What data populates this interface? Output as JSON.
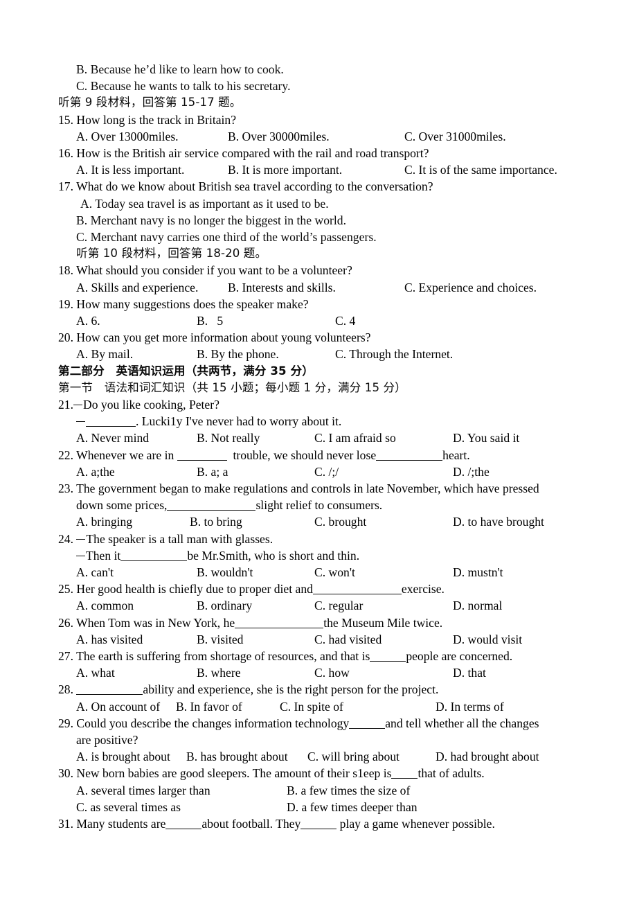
{
  "document": {
    "type": "exam-paper",
    "language": "en-zh",
    "ink_color": "#0b0b0b",
    "paper_color": "#ffffff"
  },
  "listening": {
    "carryover_options": [
      "B. Because he’d like to learn how to cook.",
      "C. Because he wants to talk to his secretary."
    ],
    "direction_9": "听第 9 段材料，回答第 15-17 题。",
    "direction_10": "听第 10 段材料，回答第 18-20 题。",
    "questions": [
      {
        "number": "15.",
        "stem": "How long is the track in Britain?",
        "layout": "three-col",
        "options": [
          "A. Over 13000miles.",
          "B. Over 30000miles.",
          "C. Over 31000miles."
        ]
      },
      {
        "number": "16.",
        "stem": "How is the British air service compared with the rail and road transport?",
        "layout": "three-col",
        "options": [
          "A. It is less important.",
          "B. It is more important.",
          "C. It is of the same importance."
        ]
      },
      {
        "number": "17.",
        "stem": "What do we know about British sea travel according to the conversation?",
        "layout": "stacked",
        "options": [
          "A. Today sea travel is as important as it used to be.",
          "B. Merchant navy is no longer the biggest in the world.",
          "C. Merchant navy carries one third of the world’s passengers."
        ]
      },
      {
        "number": "18.",
        "stem": "What should you consider if you want to be a volunteer?",
        "layout": "three-col",
        "options": [
          "A. Skills and experience.",
          "B. Interests and skills.",
          "C. Experience and choices."
        ]
      },
      {
        "number": "19.",
        "stem": "How many suggestions does the speaker make?",
        "layout": "three-col",
        "options": [
          "A. 6.",
          "B.   5",
          "C. 4"
        ]
      },
      {
        "number": "20.",
        "stem": "How can you get more information about young volunteers?",
        "layout": "three-col",
        "options": [
          "A. By mail.",
          "B. By the phone.",
          "C. Through the Internet."
        ]
      }
    ]
  },
  "part_two": {
    "heading": "第二部分　英语知识运用（共两节，满分 35 分）",
    "section_one": "第一节　语法和词汇知识（共 15 小题；每小题 1 分，满分 15 分）"
  },
  "grammar": {
    "questions": [
      {
        "number": "21.",
        "stem_lines": [
          {
            "kind": "dialog",
            "pre": "Do you like cooking, Peter?"
          },
          {
            "kind": "dialog_blank",
            "pre": "",
            "blank": "b-m",
            "post": ". Lucki1y I've never had to worry about it."
          }
        ],
        "options": [
          "A. Never mind",
          "B. Not really",
          "C. I am afraid so",
          "D. You said it"
        ],
        "cols": [
          26,
          200,
          370,
          570
        ]
      },
      {
        "number": "22.",
        "stem_lines": [
          {
            "kind": "blank2",
            "pre": "Whenever we are in ",
            "blank": "b-m",
            "mid": "  trouble, we should never lose",
            "blank2": "b-l",
            "post": "heart."
          }
        ],
        "options": [
          "A. a;the",
          "B. a; a",
          "C. /;/",
          "D. /;the"
        ],
        "cols": [
          26,
          200,
          370,
          570
        ]
      },
      {
        "number": "23.",
        "stem_lines": [
          {
            "kind": "plain",
            "pre": "The government began to make regulations and controls in late November, which have pressed"
          },
          {
            "kind": "blank1",
            "pre": "down some prices,",
            "blank": "b-xxl",
            "post": "slight relief to consumers."
          }
        ],
        "options": [
          "A. bringing",
          "B. to bring",
          "C. brought",
          "D. to have brought"
        ],
        "cols": [
          26,
          190,
          370,
          570
        ]
      },
      {
        "number": "24.",
        "stem_lines": [
          {
            "kind": "dialog",
            "pre": "The speaker is a tall man with glasses."
          },
          {
            "kind": "dialog_blank2",
            "pre": "Then it",
            "blank": "b-l",
            "post": "be Mr.Smith, who is short and thin."
          }
        ],
        "options": [
          "A. can't",
          "B. wouldn't",
          "C. won't",
          "D. mustn't"
        ],
        "cols": [
          26,
          200,
          370,
          570
        ]
      },
      {
        "number": "25.",
        "stem_lines": [
          {
            "kind": "blank1",
            "pre": "Her good health is chiefly due to proper diet and",
            "blank": "b-xxl",
            "post": "exercise."
          }
        ],
        "options": [
          "A. common",
          "B. ordinary",
          "C. regular",
          "D. normal"
        ],
        "cols": [
          26,
          200,
          370,
          570
        ]
      },
      {
        "number": "26.",
        "stem_lines": [
          {
            "kind": "blank1",
            "pre": "When Tom was in New York, he",
            "blank": "b-xxl",
            "post": "the Museum Mile twice."
          }
        ],
        "options": [
          "A. has visited",
          "B. visited",
          "C. had visited",
          "D. would visit"
        ],
        "cols": [
          26,
          200,
          370,
          570
        ]
      },
      {
        "number": "27.",
        "stem_lines": [
          {
            "kind": "blank1",
            "pre": "The earth is suffering from shortage of resources, and that is",
            "blank": "b-s",
            "post": "people are concerned."
          }
        ],
        "options": [
          "A. what",
          "B. where",
          "C. how",
          "D. that"
        ],
        "cols": [
          26,
          200,
          370,
          570
        ]
      },
      {
        "number": "28.",
        "stem_lines": [
          {
            "kind": "blank_start",
            "pre": " ",
            "blank": "b-l",
            "post": "ability and experience, she is the right person for the project."
          }
        ],
        "options": [
          "A. On account of",
          "B. In favor of",
          "C. In spite of",
          "D. In terms of"
        ],
        "cols": [
          26,
          170,
          320,
          545
        ]
      },
      {
        "number": "29.",
        "stem_lines": [
          {
            "kind": "blank1",
            "pre": "Could you describe the changes information technology",
            "blank": "b-s",
            "post": "and tell whether all the changes"
          },
          {
            "kind": "plain",
            "pre": "are positive?"
          }
        ],
        "options": [
          "A. is brought about",
          "B. has brought about",
          "C. will bring about",
          "D. had brought about"
        ],
        "cols": [
          26,
          185,
          350,
          535
        ]
      },
      {
        "number": "30.",
        "stem_lines": [
          {
            "kind": "blank1",
            "pre": "New born babies are good sleepers. The amount of their s1eep is",
            "blank": "b-xs",
            "post": "that of adults."
          }
        ],
        "options": [
          "A. several times larger than",
          "B. a few times the size of",
          "C. as several times as",
          "D. a few times deeper than"
        ],
        "layout": "two-by-two",
        "cols": [
          26,
          330
        ]
      },
      {
        "number": "31.",
        "stem_lines": [
          {
            "kind": "blank2",
            "pre": "Many students are",
            "blank": "b-s",
            "mid": "about football. They",
            "blank2": "b-s",
            "post": " play a game whenever possible."
          }
        ],
        "options": [],
        "cols": []
      }
    ]
  }
}
